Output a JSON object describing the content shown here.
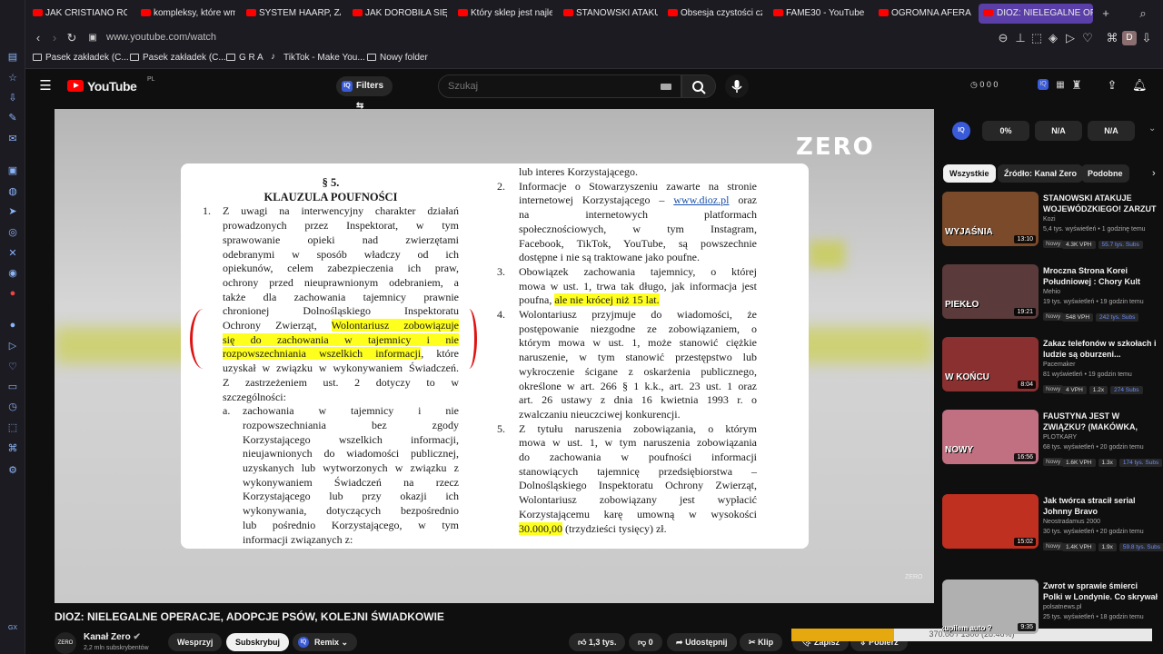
{
  "browser": {
    "tabs": [
      {
        "label": "JAK CRISTIANO RONA",
        "active": false
      },
      {
        "label": "kompleksy, które wmó",
        "active": false
      },
      {
        "label": "SYSTEM HAARP, ZAS",
        "active": false
      },
      {
        "label": "JAK DOROBIŁA SIĘ W",
        "active": false
      },
      {
        "label": "Który sklep jest najlep",
        "active": false
      },
      {
        "label": "STANOWSKI ATAKUJ",
        "active": false
      },
      {
        "label": "Obsesja czystości czy",
        "active": false
      },
      {
        "label": "FAME30 - YouTube",
        "active": false
      },
      {
        "label": "OGROMNA AFERA PE",
        "active": false
      },
      {
        "label": "DIOZ: NIELEGALNE OP",
        "active": true
      }
    ],
    "url": "www.youtube.com/watch",
    "bookmarks": [
      "Pasek zakładek (C...",
      "Pasek zakładek (C...",
      "G R A",
      "TikTok - Make You...",
      "Nowy folder"
    ],
    "profile_initial": "D"
  },
  "youtube": {
    "logo": "YouTube",
    "country": "PL",
    "filters_label": "Filters",
    "search_placeholder": "Szukaj",
    "counters": "0  0  0"
  },
  "video": {
    "watermark": "ZERO",
    "watermark_small": "ZERO",
    "doc_left": {
      "section": "§ 5.",
      "heading": "KLAUZULA POUFNOŚCI",
      "lines": [
        "Z uwagi na interwencyjny charakter działań",
        "prowadzonych przez Inspektorat, w tym",
        "sprawowanie opieki nad zwierzętami",
        "odebranymi w sposób władczy od ich",
        "opiekunów, celem zabezpieczenia ich praw,",
        "ochrony przed nieuprawnionym odebraniem, a",
        "także dla zachowania tajemnicy prawnie",
        "chronionej Dolnośląskiego Inspektoratu"
      ],
      "hl_pre": "Ochrony Zwierząt, ",
      "hl_1": "Wolontariusz zobowiązuje",
      "hl_2": "się do zachowania w tajemnicy i nie",
      "hl_3": "rozpowszechniania wszelkich informacji",
      "hl_post": ", które",
      "lines2": [
        "uzyskał w związku w wykonywaniem Świadczeń.",
        "Z zastrzeżeniem ust. 2 dotyczy to w",
        "szczególności:"
      ],
      "sub": [
        "zachowania w tajemnicy i nie",
        "rozpowszechniania bez zgody",
        "Korzystającego wszelkich informacji,",
        "nieujawnionych do wiadomości publicznej,",
        "uzyskanych lub wytworzonych w związku z",
        "wykonywaniem Świadczeń na rzecz",
        "Korzystającego lub przy okazji ich",
        "wykonywania, dotyczących bezpośrednio",
        "lub pośrednio Korzystającego, w tym",
        "informacji związanych z:"
      ],
      "num1": "1.",
      "suba": "a."
    },
    "doc_right": {
      "top": "lub interes Korzystającego.",
      "p2_num": "2.",
      "p2a": "Informacje o Stowarzyszeniu zawarte na stronie",
      "p2b_pre": "internetowej Korzystającego – ",
      "p2b_link": "www.dioz.pl",
      "p2b_post": " oraz",
      "p2": [
        "na internetowych platformach",
        "społecznościowych, w tym Instagram,",
        "Facebook, TikTok, YouTube, są powszechnie",
        "dostępne i nie są traktowane jako poufne."
      ],
      "p3_num": "3.",
      "p3": [
        "Obowiązek zachowania tajemnicy, o której",
        "mowa w ust. 1, trwa tak długo, jak informacja jest"
      ],
      "p3_last_pre": "poufna, ",
      "p3_last_hl": "ale nie krócej niż 15 lat.",
      "p4_num": "4.",
      "p4": [
        "Wolontariusz przyjmuje do wiadomości, że",
        "postępowanie niezgodne ze zobowiązaniem, o",
        "którym mowa w ust. 1, może stanowić ciężkie",
        "naruszenie, w tym stanowić przestępstwo lub",
        "wykroczenie ścigane z oskarżenia publicznego,",
        "określone w art. 266 § 1 k.k., art. 23 ust. 1 oraz",
        "art. 26 ustawy z dnia 16 kwietnia 1993 r. o",
        "zwalczaniu nieuczciwej konkurencji."
      ],
      "p5_num": "5.",
      "p5": [
        "Z tytułu naruszenia zobowiązania, o którym",
        "mowa w ust. 1, w tym naruszenia zobowiązania",
        "do zachowania w poufności informacji",
        "stanowiących tajemnicę przedsiębiorstwa –",
        "Dolnośląskiego Inspektoratu Ochrony Zwierząt,",
        "Wolontariusz zobowiązany jest wypłacić",
        "Korzystającemu karę umowną w wysokości"
      ],
      "p5_last_hl": "30.000,00",
      "p5_last_post": " (trzydzieści tysięcy) zł."
    },
    "title": "DIOZ: NIELEGALNE OPERACJE, ADOPCJE PSÓW, KOLEJNI ŚWIADKOWIE",
    "channel": {
      "avatar": "ZERO",
      "name": "Kanał Zero",
      "subs": "2,2 mln subskrybentów"
    },
    "actions": {
      "support": "Wesprzyj",
      "subscribe": "Subskrybuj",
      "remix": "Remix",
      "likes": "1,3 tys.",
      "dislikes": "0",
      "share": "Udostępnij",
      "clip": "Klip",
      "save": "Zapisz",
      "download": "Pobierz"
    },
    "overlay_label": "kupilem auto ?",
    "progress": {
      "text": "370.00 / 1300 (28.46%)",
      "fraction": 0.2846
    }
  },
  "sidebar_right": {
    "ext_pills": [
      "0%",
      "N/A",
      "N/A"
    ],
    "chips": [
      "Wszystkie",
      "Źródło: Kanał Zero",
      "Podobne"
    ],
    "recs": [
      {
        "title": "STANOWSKI ATAKUJE WOJEWÓDZKIEGO! ZARZUT ...",
        "channel": "Kozi",
        "meta": "5,4 tys. wyświetleń • 1 godzinę temu",
        "new": "Nowy",
        "badges": [
          "4.3K VPH",
          "55.7 tys. Subs"
        ],
        "duration": "13:10",
        "thumb_text": "WYJAŚNIA",
        "bg": "#7a4a2a"
      },
      {
        "title": "Mroczna Strona Korei Południowej : Chory Kult Pracy...",
        "channel": "Mehio",
        "meta": "19 tys. wyświetleń • 19 godzin temu",
        "new": "Nowy",
        "badges": [
          "548 VPH",
          "242 tys. Subs"
        ],
        "duration": "19:21",
        "thumb_text": "PIEKŁO",
        "bg": "#5a3a3a"
      },
      {
        "title": "Zakaz telefonów w szkołach i ludzie są oburzeni...",
        "channel": "Pacemaker",
        "meta": "81 wyświetleń • 19 godzin temu",
        "new": "Nowy",
        "badges": [
          "4 VPH",
          "1.2x",
          "274 Subs"
        ],
        "duration": "8:04",
        "thumb_text": "W KOŃCU",
        "bg": "#8a3030"
      },
      {
        "title": "FAUSTYNA JEST W ZWIĄZKU? (MAKÓWKA, CHAPPELL ROA...",
        "channel": "PLOTKARY",
        "meta": "68 tys. wyświetleń • 20 godzin temu",
        "new": "Nowy",
        "badges": [
          "1.6K VPH",
          "1.3x",
          "174 tys. Subs"
        ],
        "duration": "16:56",
        "thumb_text": "NOWY",
        "bg": "#c07080"
      },
      {
        "title": "Jak twórca stracił serial Johnny Bravo",
        "channel": "Neostradamus 2000",
        "meta": "30 tys. wyświetleń • 20 godzin temu",
        "new": "Nowy",
        "badges": [
          "1.4K VPH",
          "1.9x",
          "59.8 tys. Subs"
        ],
        "duration": "15:02",
        "thumb_text": "",
        "bg": "#c03020"
      },
      {
        "title": "Zwrot w sprawie śmierci Polki w Londynie. Co skrywał jej wideo?",
        "channel": "polsatnews.pl",
        "meta": "25 tys. wyświetleń • 18 godzin temu",
        "new": "",
        "badges": [],
        "duration": "9:35",
        "thumb_text": "",
        "bg": "#b0b0b0"
      }
    ]
  }
}
